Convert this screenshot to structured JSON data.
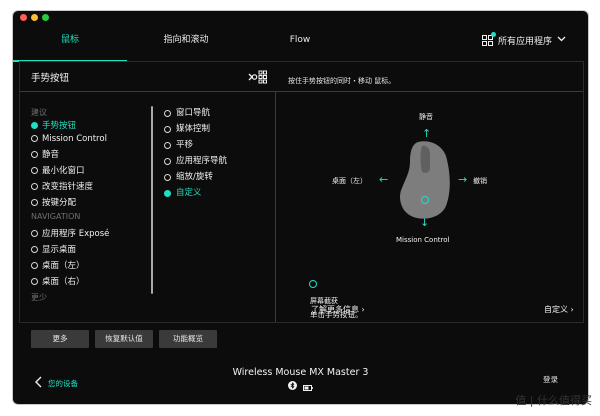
{
  "tabs": [
    {
      "label": "鼠标",
      "active": true
    },
    {
      "label": "指向和滚动",
      "active": false
    },
    {
      "label": "Flow",
      "active": false
    }
  ],
  "apps_label": "所有应用程序",
  "panel": {
    "title": "手势按钮",
    "description": "按住手势按钮的同时・移动 鼠标。"
  },
  "list": {
    "group_suggestions": "建议",
    "group_navigation": "NAVIGATION",
    "items_suggestions": [
      {
        "label": "手势按钮",
        "selected": true
      },
      {
        "label": "Mission Control",
        "selected": false
      },
      {
        "label": "静音",
        "selected": false
      },
      {
        "label": "最小化窗口",
        "selected": false
      },
      {
        "label": "改变指针速度",
        "selected": false
      },
      {
        "label": "按键分配",
        "selected": false
      }
    ],
    "items_navigation": [
      {
        "label": "应用程序 Exposé",
        "selected": false
      },
      {
        "label": "显示桌面",
        "selected": false
      },
      {
        "label": "桌面（左）",
        "selected": false
      },
      {
        "label": "桌面（右）",
        "selected": false
      }
    ],
    "less": "更少"
  },
  "gesture_options": [
    {
      "label": "窗口导航",
      "selected": false
    },
    {
      "label": "媒体控制",
      "selected": false
    },
    {
      "label": "平移",
      "selected": false
    },
    {
      "label": "应用程序导航",
      "selected": false
    },
    {
      "label": "缩放/旋转",
      "selected": false
    },
    {
      "label": "自定义",
      "selected": true
    }
  ],
  "gesture_map": {
    "up": "静音",
    "left": "桌面（左）",
    "right": "撤销",
    "down": "Mission Control",
    "click_label": "屏幕截获",
    "click_action": "单击手势按钮。"
  },
  "links": {
    "learn_more": "了解更多信息",
    "customize": "自定义"
  },
  "buttons": {
    "more": "更多",
    "restore_defaults": "恢复默认值",
    "feature_overview": "功能概览"
  },
  "bottom": {
    "back": "您的设备",
    "device": "Wireless Mouse MX Master 3",
    "login": "登录"
  },
  "watermark": "值 | 什么值得买",
  "colors": {
    "accent": "#1ee0c2",
    "background": "#0c0c0c",
    "button": "#3a3a3a"
  }
}
